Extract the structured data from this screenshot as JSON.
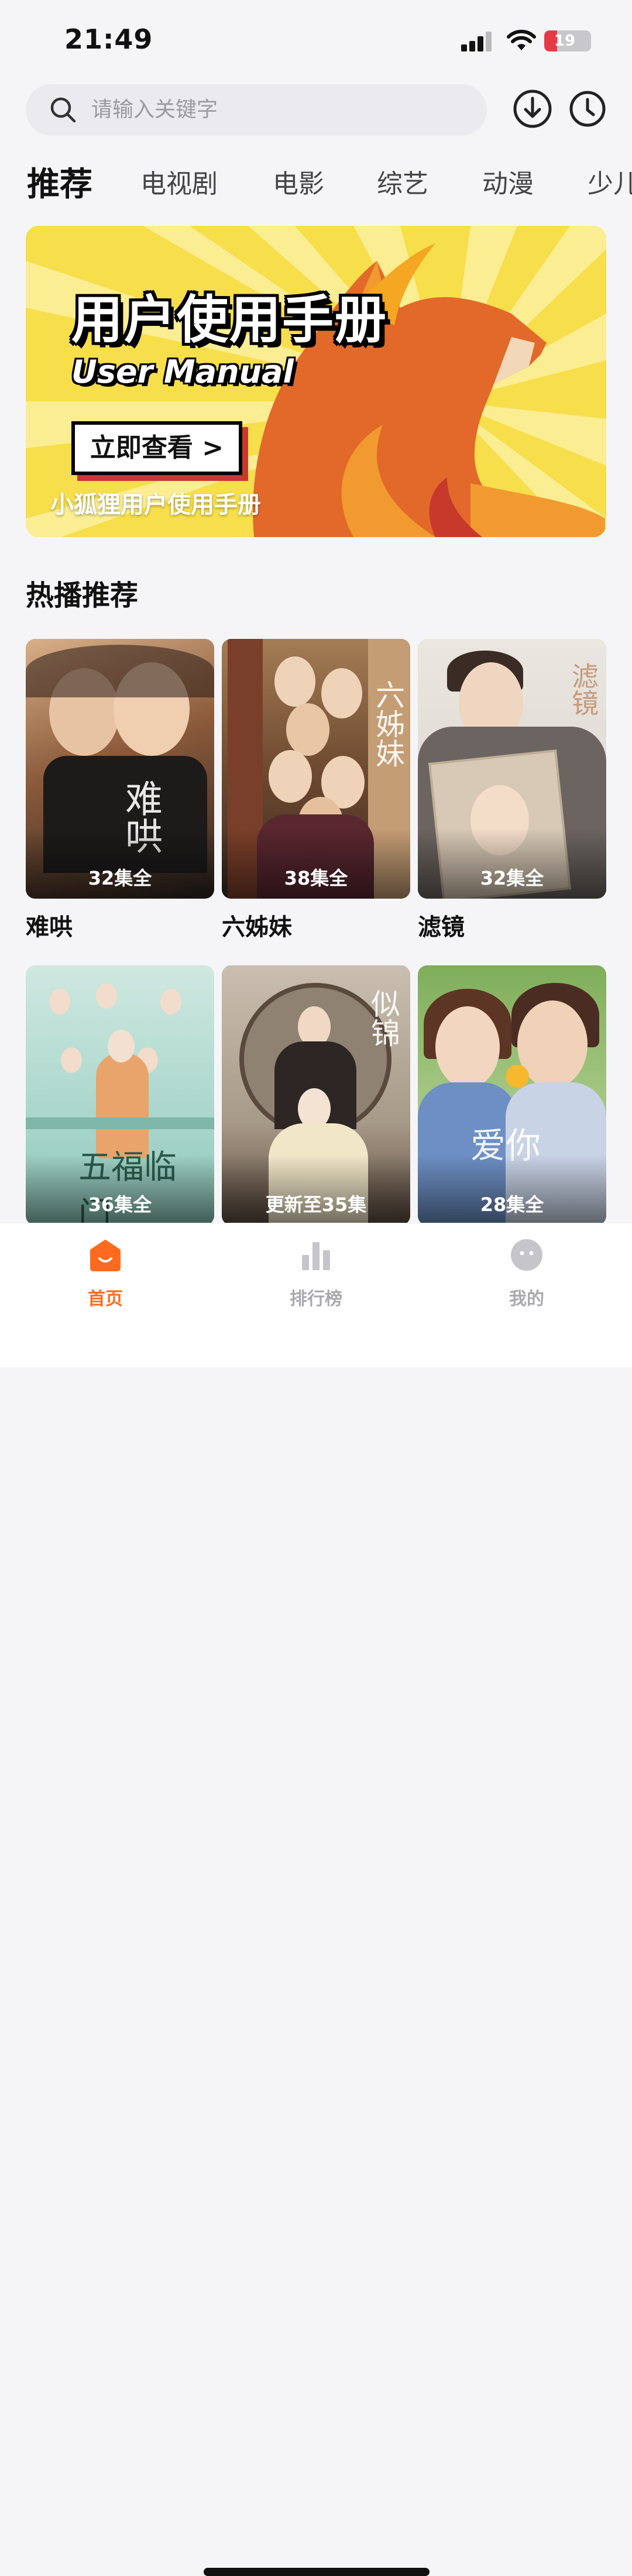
{
  "status_bar": {
    "time": "21:49",
    "battery": "19",
    "battery_level": 0.19
  },
  "search": {
    "placeholder": "请输入关键字"
  },
  "tabs": [
    {
      "label": "推荐",
      "active": true
    },
    {
      "label": "电视剧",
      "active": false
    },
    {
      "label": "电影",
      "active": false
    },
    {
      "label": "综艺",
      "active": false
    },
    {
      "label": "动漫",
      "active": false
    },
    {
      "label": "少儿",
      "active": false
    }
  ],
  "banner": {
    "title": "用户使用手册",
    "subtitle": "User Manual",
    "cta": "立即查看 >",
    "caption": "小狐狸用户使用手册"
  },
  "section": {
    "title": "热播推荐"
  },
  "shows": [
    {
      "name": "难哄",
      "episodes": "32集全",
      "poster_title": "难哄"
    },
    {
      "name": "六姊妹",
      "episodes": "38集全",
      "poster_title": "六姊妹"
    },
    {
      "name": "滤镜",
      "episodes": "32集全",
      "poster_title": "滤镜"
    },
    {
      "name": "",
      "episodes": "36集全",
      "poster_title": "五福临门"
    },
    {
      "name": "",
      "episodes": "更新至35集",
      "poster_title": "似锦"
    },
    {
      "name": "",
      "episodes": "28集全",
      "poster_title": "爱你"
    }
  ],
  "bottom_nav": [
    {
      "label": "首页",
      "icon": "home-icon",
      "active": true
    },
    {
      "label": "排行榜",
      "icon": "ranking-icon",
      "active": false
    },
    {
      "label": "我的",
      "icon": "profile-icon",
      "active": false
    }
  ],
  "colors": {
    "accent": "#ff6a1e",
    "banner_bg": "#f7de4b",
    "fox": "#e2692a",
    "battery_low": "#e63946"
  }
}
